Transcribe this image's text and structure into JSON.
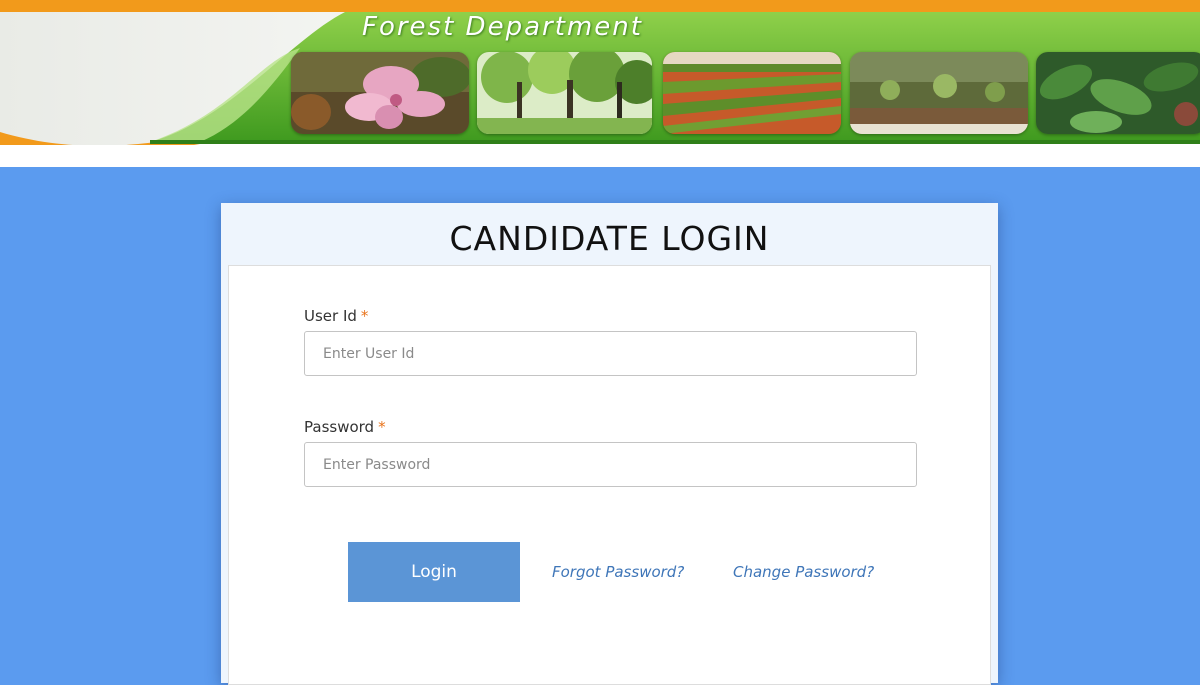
{
  "header": {
    "title": "Forest Department",
    "photos": [
      "flower-photo",
      "forest-trees-photo",
      "plantation-field-photo",
      "nursery-seedlings-photo",
      "leafy-plant-photo"
    ],
    "colors": {
      "orange": "#f29a1b",
      "green": "#5fae2c",
      "dark_green": "#2f7f19"
    }
  },
  "login": {
    "heading": "CANDIDATE LOGIN",
    "user_id": {
      "label": "User Id",
      "required_mark": "*",
      "placeholder": "Enter User Id",
      "value": ""
    },
    "password": {
      "label": "Password",
      "required_mark": "*",
      "placeholder": "Enter Password",
      "value": ""
    },
    "submit_label": "Login",
    "forgot_link": "Forgot Password?",
    "change_link": "Change Password?"
  },
  "colors": {
    "page_background": "#5b9bef",
    "button": "#5b95d6",
    "link": "#3f76b8",
    "required": "#e8731b"
  }
}
